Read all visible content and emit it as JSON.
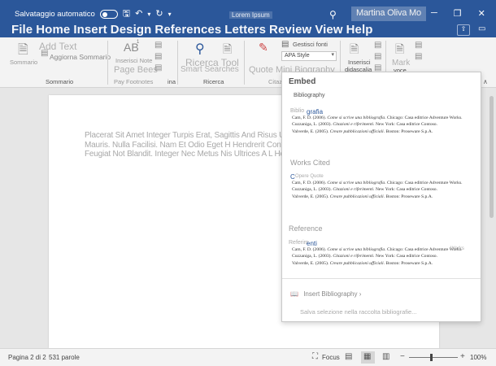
{
  "titlebar": {
    "autosave_label": "Salvataggio automatico",
    "doc_name": "Lorem Ipsum",
    "user_name": "Martina Oliva Mo",
    "icons": [
      "save-icon",
      "undo-icon",
      "redo-icon",
      "search-icon",
      "minimize-icon",
      "restore-icon",
      "close-icon"
    ],
    "save_glyph": "🖫",
    "undo_glyph": "↶",
    "undo_arrow": "▾",
    "redo_glyph": "↻",
    "search_glyph": "⚲",
    "min_glyph": "─",
    "max_glyph": "❐",
    "close_glyph": "✕",
    "share_glyph": "⇧",
    "comment_glyph": "▭"
  },
  "menu": {
    "tabs": [
      "File",
      "Home",
      "Insert",
      "Design",
      "References",
      "Letters",
      "Review",
      "View",
      "Help"
    ],
    "active_tab": "References"
  },
  "ribbon": {
    "summary_btn": "Sommario",
    "add_text": "Add Text",
    "update_summary": "Aggiorna Sommario",
    "insert_note_line1": "Inserisci Note",
    "insert_note_line2": "Page Bees",
    "footnote_icon_glyph": "AB",
    "footnote_sup": "1",
    "footnote_group": "Pay Footnotes",
    "group_summary": "Sommario",
    "group_suffix": "ina",
    "search_btn_line1": "Ricerca Tool",
    "search_btn_line2": "Smart Searches",
    "group_search": "Ricerca",
    "citation_line1": "Quote Mini Biography",
    "citation_line2": "Citazi",
    "manage_sources": "Gestisci fonti",
    "style_label": "APA Style",
    "insert_caption_line1": "Inserisci",
    "insert_caption_line2": "didascalia",
    "mark_line1": "Mark",
    "mark_line2": "voce",
    "collapse_glyph": "∧",
    "ico_doc": "🗎",
    "ico_small": "▤",
    "ico_search": "⚲",
    "ico_cite": "✎",
    "ico_book": "📖",
    "ico_stack": "▤▤"
  },
  "document": {
    "body_text": "Placerat Sit Amet Integer Turpis Erat, Sagittis And Risus Ut Iusto Justo Mauris. Nulla Facilisi. Nam Et Odio Eget H Hendrerit Convallis Nothing Feugiat Not Blandit. Integer Nec Metus Nis Ultrices A L Hendrent Nibh."
  },
  "dropdown": {
    "header": "Embed",
    "items": [
      {
        "subtitle": "Bibliography",
        "ghost_label": "Biblio",
        "title_link": "grafia",
        "entries": [
          {
            "plain": "Cam, F. D. (2006). ",
            "italic": "Come si scrive una bibliografia",
            "tail": ". Chicago: Casa editrice Adventure Works."
          },
          {
            "plain": "Cuzzaniga, L. (2003). ",
            "italic": "Citazioni e riferimenti",
            "tail": ". New York: Casa editrice Contoso."
          },
          {
            "plain": "Valverde, E. (2005). ",
            "italic": "Creare pubblicazioni ufficiali",
            "tail": ". Boston: Proseware S.p.A."
          }
        ]
      },
      {
        "subtitle": "Works Cited",
        "ghost_label": "Opere Quote",
        "title_link": "C",
        "entries": [
          {
            "plain": "Cam, F. D. (2006). ",
            "italic": "Come si scrive una bibliografia",
            "tail": ". Chicago: Casa editrice Adventure Works."
          },
          {
            "plain": "Cuzzaniga, L. (2003). ",
            "italic": "Citazioni e riferimenti",
            "tail": ". New York: Casa editrice Contoso."
          },
          {
            "plain": "Valverde, E. (2005). ",
            "italic": "Creare pubblicazioni ufficiali",
            "tail": ". Boston: Proseware S.p.A."
          }
        ]
      },
      {
        "subtitle": "Reference",
        "ghost_label": "Referim",
        "title_link": "enti",
        "entries": [
          {
            "plain": "Cam, F. D. (2006). ",
            "italic": "Come si scrive una bibliografia",
            "tail": ". Chicago: Casa editrice Adventure Works."
          },
          {
            "plain": "Cuzzaniga, L. (2003). ",
            "italic": "Citazioni e riferimenti",
            "tail": ". New York: Casa editrice Contoso."
          },
          {
            "plain": "Valverde, E. (2005). ",
            "italic": "Creare pubblicazioni ufficiali",
            "tail": ". Boston: Proseware S.p.A."
          }
        ]
      }
    ],
    "ghost_tail": "Works",
    "insert_bibliography": "Insert Bibliography",
    "insert_bibliography_arrow": "›",
    "save_selection": "Salva selezione nella raccolta bibliografie...",
    "bib_glyph": "📖"
  },
  "status": {
    "page": "Pagina 2 di 2",
    "words": "531 parole",
    "focus": "Focus",
    "zoom": "100%",
    "zoom_level": 100,
    "book_glyph": "📖",
    "focus_glyph": "⛶",
    "view1_glyph": "▤",
    "view2_glyph": "▦",
    "view3_glyph": "▥",
    "minus": "−",
    "plus": "+"
  }
}
